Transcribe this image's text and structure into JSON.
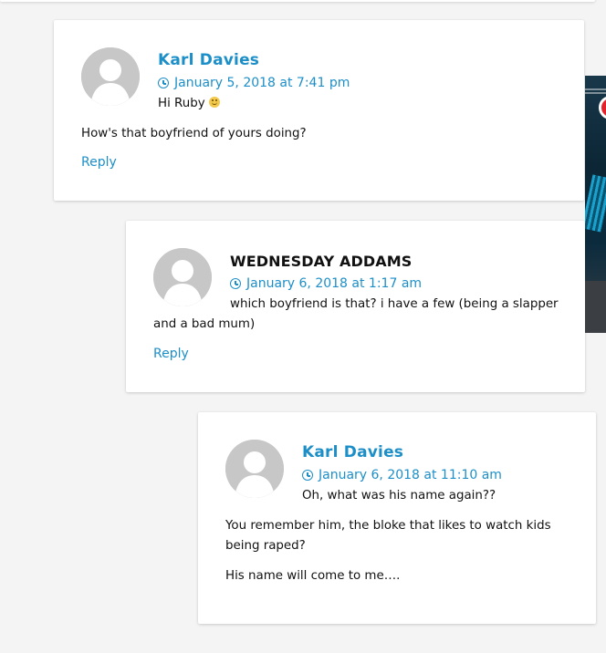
{
  "comments": [
    {
      "author": "Karl Davies",
      "date": "January 5, 2018 at 7:41 pm",
      "paragraphs": [
        "Hi Ruby",
        "How's that boyfriend of yours doing?"
      ],
      "reply_label": "Reply",
      "emoji": "slightly-smiling-face-icon"
    },
    {
      "author": "WEDNESDAY ADDAMS",
      "date": "January 6, 2018 at 1:17 am",
      "paragraphs": [
        "which boyfriend is that? i have a few (being a slapper and a bad mum)"
      ],
      "reply_label": "Reply"
    },
    {
      "author": "Karl Davies",
      "date": "January 6, 2018 at 11:10 am",
      "paragraphs": [
        "Oh, what was his name again??",
        "You remember him, the bloke that likes to watch kids being raped?",
        "His name will come to me…."
      ]
    }
  ],
  "colors": {
    "link": "#1d8fc8",
    "text": "#111111",
    "background": "#f4f4f4",
    "card": "#ffffff",
    "avatar": "#c7c7c7"
  }
}
